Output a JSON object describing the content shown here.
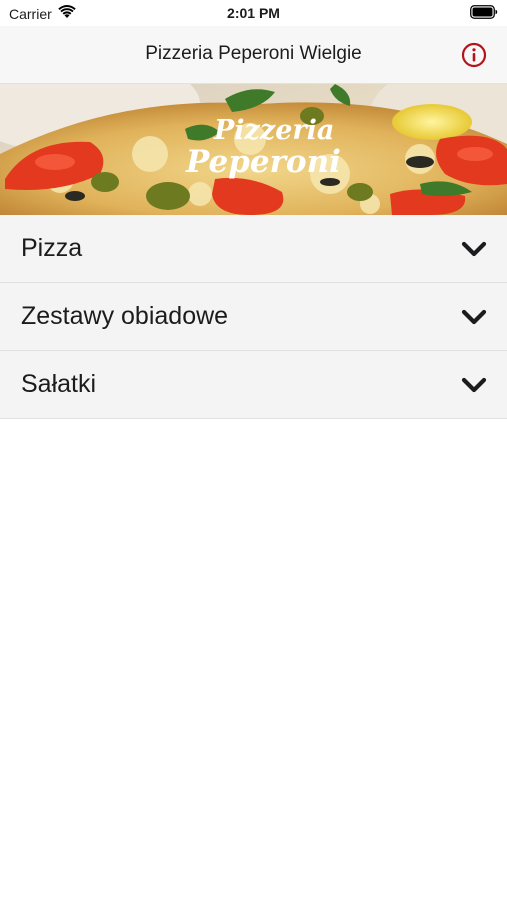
{
  "status_bar": {
    "carrier": "Carrier",
    "time": "2:01 PM"
  },
  "nav": {
    "title": "Pizzeria Peperoni Wielgie"
  },
  "banner": {
    "logo_line1": "Pizzeria",
    "logo_line2": "Peperoni"
  },
  "categories": [
    {
      "label": "Pizza"
    },
    {
      "label": "Zestawy obiadowe"
    },
    {
      "label": "Sałatki"
    }
  ],
  "colors": {
    "accent_red": "#b3141b",
    "nav_background": "#f7f7f7",
    "row_background": "#f4f4f4"
  },
  "icons": {
    "wifi": "wifi-icon",
    "battery": "battery-icon",
    "info": "info-icon",
    "chevron": "chevron-down-icon"
  }
}
